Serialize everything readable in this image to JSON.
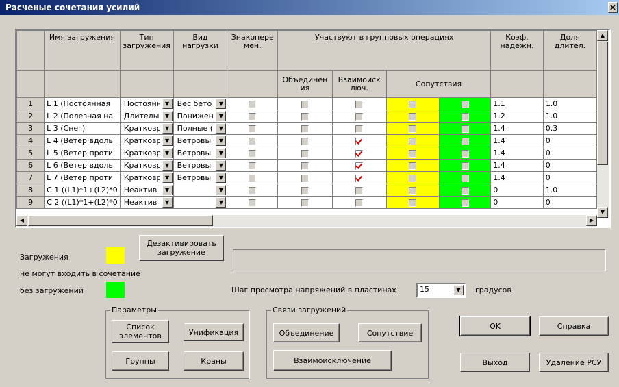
{
  "window": {
    "title": "Расченые сочетания усилий"
  },
  "grid": {
    "headers": {
      "name": "Имя загружения",
      "type": "Тип загружения",
      "kind": "Вид нагрузки",
      "sign": "Знакопере мен.",
      "group": "Участвуют в групповых операциях",
      "union": "Объединен ия",
      "mutex": "Взаимоиск люч.",
      "accomp": "Сопутствия",
      "coef": "Коэф. надежн.",
      "share": "Доля длител."
    },
    "rows": [
      {
        "num": "1",
        "name": "L 1 (Постоянная",
        "type": "Постоянн",
        "kind": "Вес бето",
        "mutex": false,
        "coef": "1.1",
        "share": "1.0"
      },
      {
        "num": "2",
        "name": "L 2 (Полезная на",
        "type": "Длителы",
        "kind": "Понижен",
        "mutex": false,
        "coef": "1.2",
        "share": "1.0"
      },
      {
        "num": "3",
        "name": "L 3 (Снег)",
        "type": "Кратковр",
        "kind": "Полные (",
        "mutex": false,
        "coef": "1.4",
        "share": "0.3"
      },
      {
        "num": "4",
        "name": "L 4 (Ветер вдоль",
        "type": "Кратковр",
        "kind": "Ветровы",
        "mutex": true,
        "coef": "1.4",
        "share": "0"
      },
      {
        "num": "5",
        "name": "L 5 (Ветер проти",
        "type": "Кратковр",
        "kind": "Ветровы",
        "mutex": true,
        "coef": "1.4",
        "share": "0"
      },
      {
        "num": "6",
        "name": "L 6 (Ветер вдоль",
        "type": "Кратковр",
        "kind": "Ветровы",
        "mutex": true,
        "coef": "1.4",
        "share": "0"
      },
      {
        "num": "7",
        "name": "L 7 (Ветер проти",
        "type": "Кратковр",
        "kind": "Ветровы",
        "mutex": true,
        "coef": "1.4",
        "share": "0"
      },
      {
        "num": "8",
        "name": "C 1 ((L1)*1+(L2)*0",
        "type": "Неактив",
        "kind": "",
        "mutex": false,
        "coef": "0",
        "share": "1.0"
      },
      {
        "num": "9",
        "name": "C 2 ((L1)*1+(L2)*0",
        "type": "Неактив",
        "kind": "",
        "mutex": false,
        "coef": "0",
        "share": "0"
      }
    ]
  },
  "legend": {
    "loads_label": "Загружения",
    "cannot_combine": "не могут входить в сочетание",
    "without_loads": "без загружений",
    "yellow": "#ffff00",
    "green": "#00ff00"
  },
  "deactivate_button": "Дезактивировать загружение",
  "step": {
    "label": "Шаг просмотра напряжений в пластинах",
    "value": "15",
    "unit": "градусов"
  },
  "params": {
    "title": "Параметры",
    "element_list": "Список элементов",
    "unification": "Унификация",
    "groups": "Группы",
    "cranes": "Краны"
  },
  "links": {
    "title": "Связи загружений",
    "union": "Объединение",
    "accompany": "Сопутствие",
    "mutex": "Взаимоисключение"
  },
  "buttons": {
    "ok": "OK",
    "help": "Справка",
    "exit": "Выход",
    "delete_rsu": "Удаление РСУ"
  }
}
